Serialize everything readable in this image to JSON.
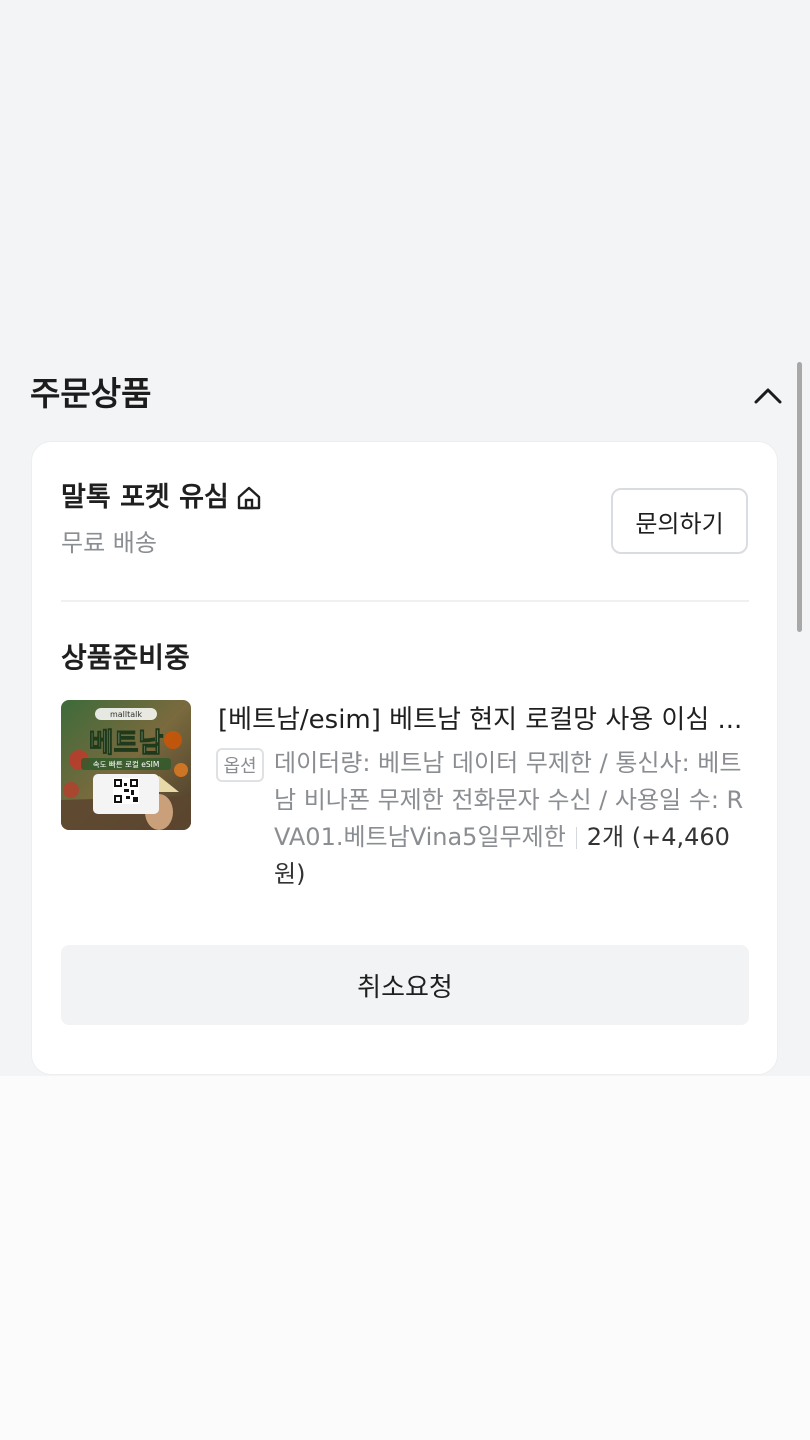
{
  "section": {
    "title": "주문상품",
    "collapse_icon": "chevron-up-icon"
  },
  "order": {
    "seller": {
      "name": "말톡 포켓 유심",
      "store_icon": "home-icon",
      "shipping": "무료 배송",
      "inquiry_label": "문의하기"
    },
    "status": "상품준비중",
    "product": {
      "thumbnail_text": "베트남",
      "thumbnail_subtext": "속도 빠른 로컬 eSIM",
      "thumbnail_brand": "malltalk",
      "title": "[베트남/esim] 베트남 현지 로컬망 사용 이심 ...",
      "option_badge": "옵션",
      "option_text": "데이터량: 베트남 데이터 무제한 / 통신사: 베트남 비나폰 무제한 전화문자 수신 / 사용일 수: RVA01.베트남Vina5일무제한",
      "quantity_price": "2개 (+4,460원)"
    },
    "cancel_label": "취소요청"
  },
  "colors": {
    "page_bg": "#f2f4f6",
    "card_bg": "#ffffff",
    "muted_text": "#8a8d91",
    "button_bg": "#f2f3f5"
  }
}
